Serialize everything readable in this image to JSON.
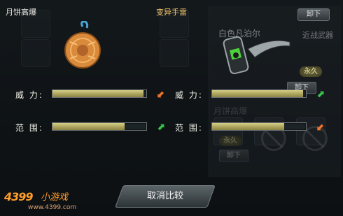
{
  "window": {
    "title": "变异手雷",
    "left_item_name": "月饼高爆",
    "top_button": "卸下",
    "cancel_button": "取消比较"
  },
  "right_item": {
    "name": "白色凡泊尔",
    "type": "近战武器",
    "durability_badge": "永久",
    "unequip_label": "卸下"
  },
  "stats": {
    "left": [
      {
        "label": "威 力:",
        "value": 0.97,
        "indicator": "down-arrow"
      },
      {
        "label": "范 围:",
        "value": 0.77,
        "indicator": "up-arrow"
      }
    ],
    "right": [
      {
        "label": "威 力:",
        "value": 0.97,
        "indicator": "up-arrow"
      },
      {
        "label": "范 围:",
        "value": 0.77,
        "indicator": "down-arrow"
      }
    ]
  },
  "background_panel": {
    "item_title": "月饼高爆",
    "badge": "永久",
    "unequip_label": "卸下"
  },
  "colors": {
    "title_color": "#f2c76c",
    "bar_fill": "#c8c07a",
    "up_arrow": "#35c24a",
    "down_arrow": "#f0742a"
  },
  "branding": {
    "logo": "4399",
    "logo_suffix": "小游戏",
    "url": "www.4399.com"
  }
}
